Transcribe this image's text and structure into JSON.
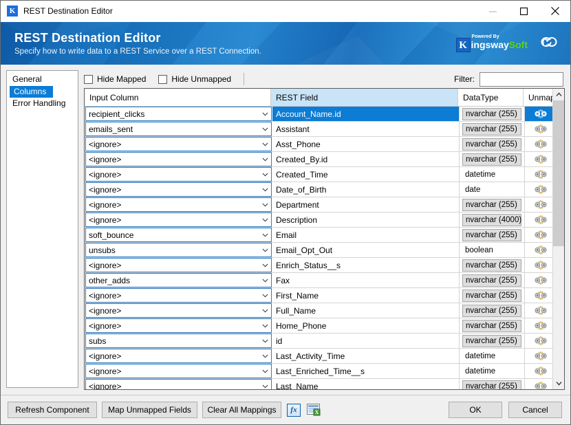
{
  "window": {
    "title": "REST Destination Editor",
    "app_icon": "K",
    "minimize_label": "Minimize",
    "maximize_label": "Maximize",
    "close_label": "Close"
  },
  "banner": {
    "title": "REST Destination Editor",
    "subtitle": "Specify how to write data to a REST Service over a REST Connection.",
    "logo": {
      "mark": "K",
      "powered_by": "Powered By",
      "name_part1": "ingsway",
      "name_part2": "Soft"
    },
    "link_icon": "link-icon",
    "accent_color": "#1b6fc0",
    "green_color": "#5dd21e"
  },
  "sidebar": {
    "items": [
      {
        "label": "General",
        "selected": false
      },
      {
        "label": "Columns",
        "selected": true
      },
      {
        "label": "Error Handling",
        "selected": false
      }
    ]
  },
  "toolbar": {
    "hide_mapped_label": "Hide Mapped",
    "hide_mapped_checked": false,
    "hide_unmapped_label": "Hide Unmapped",
    "hide_unmapped_checked": false,
    "filter_label": "Filter:",
    "filter_value": "",
    "filter_placeholder": ""
  },
  "grid": {
    "columns": [
      "Input Column",
      "REST Field",
      "DataType",
      "Unmap"
    ],
    "selection_color": "#0c7cd5",
    "rest_header_color": "#c9e3f7",
    "rows": [
      {
        "input": "recipient_clicks",
        "rest": "Account_Name.id",
        "type": "nvarchar (255)",
        "pill": true,
        "selected": true
      },
      {
        "input": "emails_sent",
        "rest": "Assistant",
        "type": "nvarchar (255)",
        "pill": true,
        "selected": false
      },
      {
        "input": "<ignore>",
        "rest": "Asst_Phone",
        "type": "nvarchar (255)",
        "pill": true,
        "selected": false
      },
      {
        "input": "<ignore>",
        "rest": "Created_By.id",
        "type": "nvarchar (255)",
        "pill": true,
        "selected": false
      },
      {
        "input": "<ignore>",
        "rest": "Created_Time",
        "type": "datetime",
        "pill": false,
        "selected": false
      },
      {
        "input": "<ignore>",
        "rest": "Date_of_Birth",
        "type": "date",
        "pill": false,
        "selected": false
      },
      {
        "input": "<ignore>",
        "rest": "Department",
        "type": "nvarchar (255)",
        "pill": true,
        "selected": false
      },
      {
        "input": "<ignore>",
        "rest": "Description",
        "type": "nvarchar (4000)",
        "pill": true,
        "selected": false
      },
      {
        "input": "soft_bounce",
        "rest": "Email",
        "type": "nvarchar (255)",
        "pill": true,
        "selected": false
      },
      {
        "input": "unsubs",
        "rest": "Email_Opt_Out",
        "type": "boolean",
        "pill": false,
        "selected": false
      },
      {
        "input": "<ignore>",
        "rest": "Enrich_Status__s",
        "type": "nvarchar (255)",
        "pill": true,
        "selected": false
      },
      {
        "input": "other_adds",
        "rest": "Fax",
        "type": "nvarchar (255)",
        "pill": true,
        "selected": false
      },
      {
        "input": "<ignore>",
        "rest": "First_Name",
        "type": "nvarchar (255)",
        "pill": true,
        "selected": false
      },
      {
        "input": "<ignore>",
        "rest": "Full_Name",
        "type": "nvarchar (255)",
        "pill": true,
        "selected": false
      },
      {
        "input": "<ignore>",
        "rest": "Home_Phone",
        "type": "nvarchar (255)",
        "pill": true,
        "selected": false
      },
      {
        "input": "subs",
        "rest": "id",
        "type": "nvarchar (255)",
        "pill": true,
        "selected": false
      },
      {
        "input": "<ignore>",
        "rest": "Last_Activity_Time",
        "type": "datetime",
        "pill": false,
        "selected": false
      },
      {
        "input": "<ignore>",
        "rest": "Last_Enriched_Time__s",
        "type": "datetime",
        "pill": false,
        "selected": false
      },
      {
        "input": "<ignore>",
        "rest": "Last_Name",
        "type": "nvarchar (255)",
        "pill": true,
        "selected": false
      }
    ]
  },
  "footer": {
    "refresh_label": "Refresh Component",
    "map_unmapped_label": "Map Unmapped Fields",
    "clear_mappings_label": "Clear All Mappings",
    "fx_label": "fx",
    "export_icon": "export-grid-icon",
    "ok_label": "OK",
    "cancel_label": "Cancel"
  }
}
